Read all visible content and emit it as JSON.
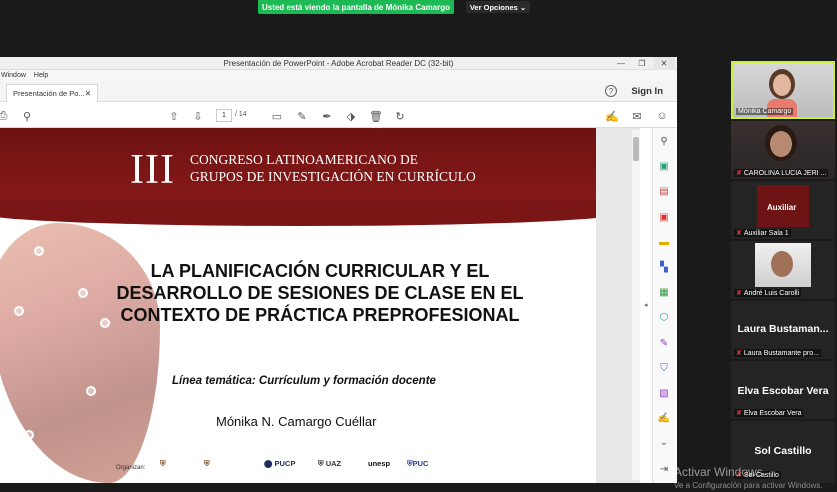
{
  "zoom": {
    "share_banner": "Usted está viendo la pantalla de Mónika Camargo",
    "view_options": "Ver Opciones ⌄"
  },
  "acrobat": {
    "window_title": "Presentación de PowerPoint - Adobe Acrobat Reader DC (32-bit)",
    "menu": [
      "Window",
      "Help"
    ],
    "tab_label": "Presentación de Po...",
    "sign_in": "Sign In",
    "page_current": "1",
    "page_total": "/ 14"
  },
  "slide": {
    "roman": "III",
    "congress_line1": "CONGRESO LATINOAMERICANO DE",
    "congress_line2": "GRUPOS DE INVESTIGACIÓN EN CURRÍCULO",
    "title_line1": "LA PLANIFICACIÓN CURRICULAR Y EL",
    "title_line2": "DESARROLLO DE SESIONES DE CLASE EN EL",
    "title_line3": "CONTEXTO DE PRÁCTICA PREPROFESIONAL",
    "linea": "Línea temática: Currículum y formación docente",
    "author": "Mónika N. Camargo Cuéllar",
    "organizan": "Organizan:",
    "logos": [
      "PUCP",
      "UAZ",
      "unesp",
      "PUC"
    ]
  },
  "participants": [
    {
      "name": "Mónika Camargo"
    },
    {
      "name": "CAROLINA LUCIA JERI ..."
    },
    {
      "name": "Auxiliar Sala 1",
      "thumb_label": "Auxiliar"
    },
    {
      "name": "André Luis Carolli"
    },
    {
      "name": "Laura Bustamante pro...",
      "big": "Laura Bustaman..."
    },
    {
      "name": "Elva Escobar Vera",
      "big": "Elva Escobar Vera"
    },
    {
      "name": "Sol Castillo",
      "big": "Sol Castillo"
    }
  ],
  "windows_watermark": {
    "line1": "Activar Windows",
    "line2": "Ve a Configuración para activar Windows."
  }
}
